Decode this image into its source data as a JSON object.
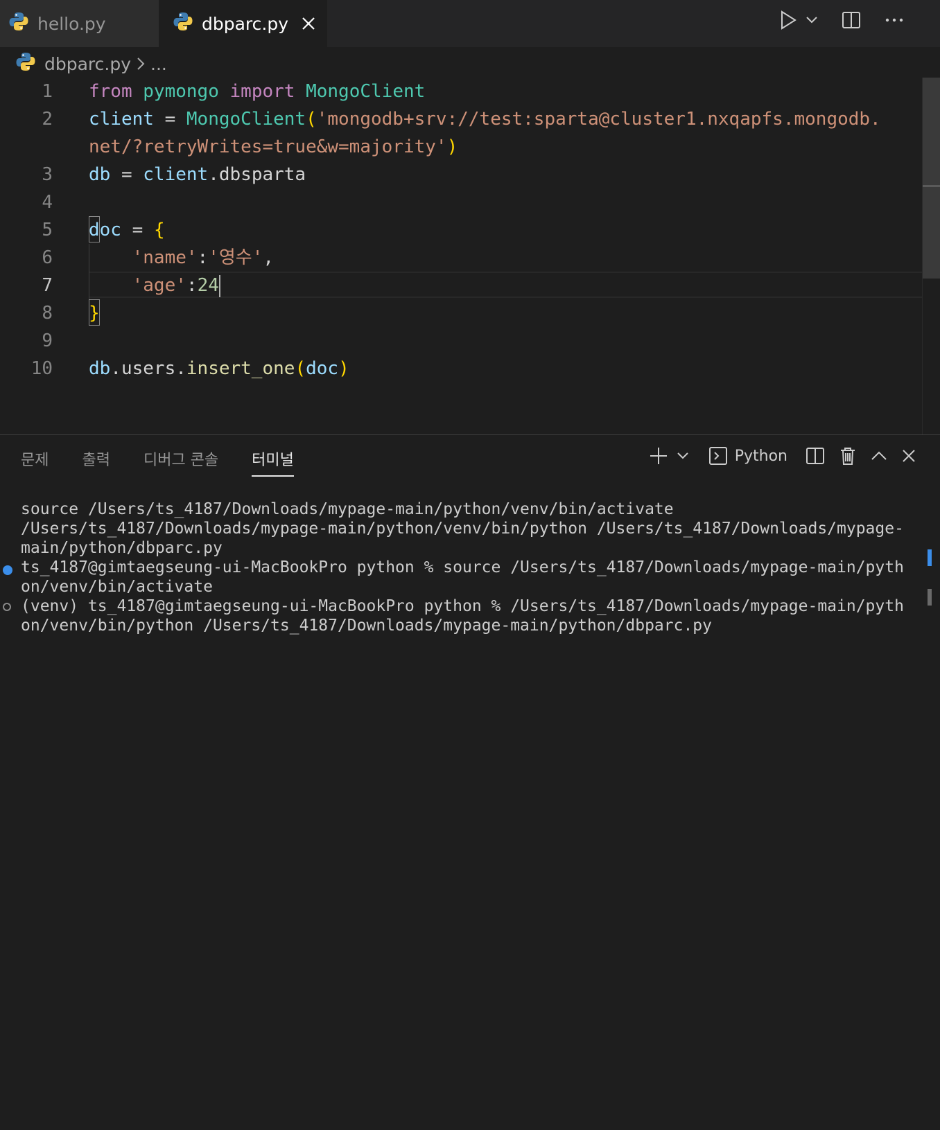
{
  "tabs": [
    {
      "label": "hello.py",
      "icon": "python-icon"
    },
    {
      "label": "dbparc.py",
      "icon": "python-icon",
      "active": true
    }
  ],
  "breadcrumb": {
    "file": "dbparc.py",
    "rest": "..."
  },
  "line_numbers": [
    "1",
    "2",
    "3",
    "4",
    "5",
    "6",
    "7",
    "8",
    "9",
    "10"
  ],
  "code": {
    "l1": {
      "kw1": "from",
      "mod": "pymongo",
      "kw2": "import",
      "cls": "MongoClient"
    },
    "l2": {
      "var": "client",
      "op": "=",
      "fn": "MongoClient",
      "open": "(",
      "str_a": "'mongodb+srv://test:sparta@cluster1.nxqapfs.mongodb.",
      "str_b": "net/?retryWrites=true&w=majority'",
      "close": ")"
    },
    "l3": {
      "var": "db",
      "op": "=",
      "obj": "client",
      "attr": ".dbsparta"
    },
    "l5": {
      "var": "doc",
      "op": "=",
      "brace": "{"
    },
    "l6": {
      "key": "'name'",
      "colon": ":",
      "val": "'영수'",
      "comma": ","
    },
    "l7": {
      "key": "'age'",
      "colon": ":",
      "val": "24"
    },
    "l8": {
      "brace": "}"
    },
    "l10": {
      "obj": "db",
      "attr": ".users.",
      "fn": "insert_one",
      "open": "(",
      "arg": "doc",
      "close": ")"
    }
  },
  "panel": {
    "tabs": [
      "문제",
      "출력",
      "디버그 콘솔",
      "터미널"
    ],
    "active_tab": "터미널",
    "terminal_profile": "Python"
  },
  "terminal": {
    "lines": [
      "source /Users/ts_4187/Downloads/mypage-main/python/venv/bin/activate",
      "/Users/ts_4187/Downloads/mypage-main/python/venv/bin/python /Users/ts_4187/Downloads/mypage-",
      "main/python/dbparc.py",
      "ts_4187@gimtaegseung-ui-MacBookPro python % source /Users/ts_4187/Downloads/mypage-main/pyth",
      "on/venv/bin/activate",
      "(venv) ts_4187@gimtaegseung-ui-MacBookPro python % /Users/ts_4187/Downloads/mypage-main/pyth",
      "on/venv/bin/python /Users/ts_4187/Downloads/mypage-main/python/dbparc.py"
    ]
  },
  "colors": {
    "background": "#1e1e1e",
    "keyword": "#c586c0",
    "module": "#4ec9b0",
    "variable": "#9cdcfe",
    "function": "#dcdcaa",
    "string": "#ce9178",
    "number": "#b5cea8",
    "accent": "#3b8eea"
  }
}
